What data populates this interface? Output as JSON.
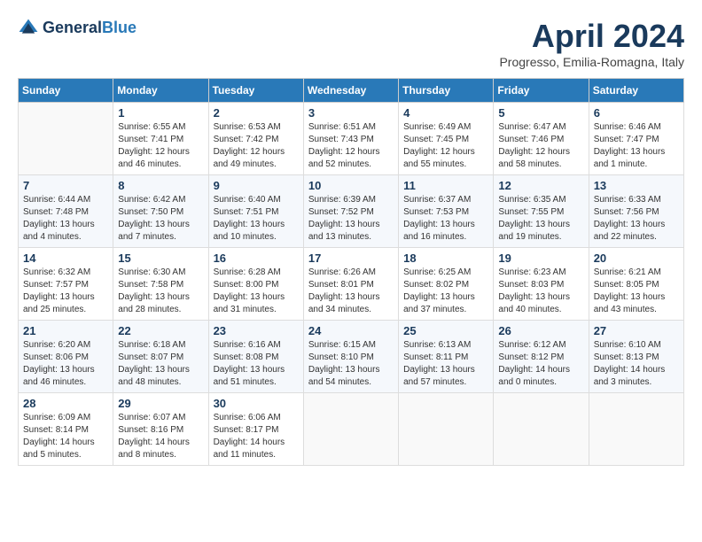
{
  "header": {
    "logo_line1": "General",
    "logo_line2": "Blue",
    "title": "April 2024",
    "subtitle": "Progresso, Emilia-Romagna, Italy"
  },
  "weekdays": [
    "Sunday",
    "Monday",
    "Tuesday",
    "Wednesday",
    "Thursday",
    "Friday",
    "Saturday"
  ],
  "weeks": [
    [
      {
        "day": "",
        "sunrise": "",
        "sunset": "",
        "daylight": ""
      },
      {
        "day": "1",
        "sunrise": "Sunrise: 6:55 AM",
        "sunset": "Sunset: 7:41 PM",
        "daylight": "Daylight: 12 hours and 46 minutes."
      },
      {
        "day": "2",
        "sunrise": "Sunrise: 6:53 AM",
        "sunset": "Sunset: 7:42 PM",
        "daylight": "Daylight: 12 hours and 49 minutes."
      },
      {
        "day": "3",
        "sunrise": "Sunrise: 6:51 AM",
        "sunset": "Sunset: 7:43 PM",
        "daylight": "Daylight: 12 hours and 52 minutes."
      },
      {
        "day": "4",
        "sunrise": "Sunrise: 6:49 AM",
        "sunset": "Sunset: 7:45 PM",
        "daylight": "Daylight: 12 hours and 55 minutes."
      },
      {
        "day": "5",
        "sunrise": "Sunrise: 6:47 AM",
        "sunset": "Sunset: 7:46 PM",
        "daylight": "Daylight: 12 hours and 58 minutes."
      },
      {
        "day": "6",
        "sunrise": "Sunrise: 6:46 AM",
        "sunset": "Sunset: 7:47 PM",
        "daylight": "Daylight: 13 hours and 1 minute."
      }
    ],
    [
      {
        "day": "7",
        "sunrise": "Sunrise: 6:44 AM",
        "sunset": "Sunset: 7:48 PM",
        "daylight": "Daylight: 13 hours and 4 minutes."
      },
      {
        "day": "8",
        "sunrise": "Sunrise: 6:42 AM",
        "sunset": "Sunset: 7:50 PM",
        "daylight": "Daylight: 13 hours and 7 minutes."
      },
      {
        "day": "9",
        "sunrise": "Sunrise: 6:40 AM",
        "sunset": "Sunset: 7:51 PM",
        "daylight": "Daylight: 13 hours and 10 minutes."
      },
      {
        "day": "10",
        "sunrise": "Sunrise: 6:39 AM",
        "sunset": "Sunset: 7:52 PM",
        "daylight": "Daylight: 13 hours and 13 minutes."
      },
      {
        "day": "11",
        "sunrise": "Sunrise: 6:37 AM",
        "sunset": "Sunset: 7:53 PM",
        "daylight": "Daylight: 13 hours and 16 minutes."
      },
      {
        "day": "12",
        "sunrise": "Sunrise: 6:35 AM",
        "sunset": "Sunset: 7:55 PM",
        "daylight": "Daylight: 13 hours and 19 minutes."
      },
      {
        "day": "13",
        "sunrise": "Sunrise: 6:33 AM",
        "sunset": "Sunset: 7:56 PM",
        "daylight": "Daylight: 13 hours and 22 minutes."
      }
    ],
    [
      {
        "day": "14",
        "sunrise": "Sunrise: 6:32 AM",
        "sunset": "Sunset: 7:57 PM",
        "daylight": "Daylight: 13 hours and 25 minutes."
      },
      {
        "day": "15",
        "sunrise": "Sunrise: 6:30 AM",
        "sunset": "Sunset: 7:58 PM",
        "daylight": "Daylight: 13 hours and 28 minutes."
      },
      {
        "day": "16",
        "sunrise": "Sunrise: 6:28 AM",
        "sunset": "Sunset: 8:00 PM",
        "daylight": "Daylight: 13 hours and 31 minutes."
      },
      {
        "day": "17",
        "sunrise": "Sunrise: 6:26 AM",
        "sunset": "Sunset: 8:01 PM",
        "daylight": "Daylight: 13 hours and 34 minutes."
      },
      {
        "day": "18",
        "sunrise": "Sunrise: 6:25 AM",
        "sunset": "Sunset: 8:02 PM",
        "daylight": "Daylight: 13 hours and 37 minutes."
      },
      {
        "day": "19",
        "sunrise": "Sunrise: 6:23 AM",
        "sunset": "Sunset: 8:03 PM",
        "daylight": "Daylight: 13 hours and 40 minutes."
      },
      {
        "day": "20",
        "sunrise": "Sunrise: 6:21 AM",
        "sunset": "Sunset: 8:05 PM",
        "daylight": "Daylight: 13 hours and 43 minutes."
      }
    ],
    [
      {
        "day": "21",
        "sunrise": "Sunrise: 6:20 AM",
        "sunset": "Sunset: 8:06 PM",
        "daylight": "Daylight: 13 hours and 46 minutes."
      },
      {
        "day": "22",
        "sunrise": "Sunrise: 6:18 AM",
        "sunset": "Sunset: 8:07 PM",
        "daylight": "Daylight: 13 hours and 48 minutes."
      },
      {
        "day": "23",
        "sunrise": "Sunrise: 6:16 AM",
        "sunset": "Sunset: 8:08 PM",
        "daylight": "Daylight: 13 hours and 51 minutes."
      },
      {
        "day": "24",
        "sunrise": "Sunrise: 6:15 AM",
        "sunset": "Sunset: 8:10 PM",
        "daylight": "Daylight: 13 hours and 54 minutes."
      },
      {
        "day": "25",
        "sunrise": "Sunrise: 6:13 AM",
        "sunset": "Sunset: 8:11 PM",
        "daylight": "Daylight: 13 hours and 57 minutes."
      },
      {
        "day": "26",
        "sunrise": "Sunrise: 6:12 AM",
        "sunset": "Sunset: 8:12 PM",
        "daylight": "Daylight: 14 hours and 0 minutes."
      },
      {
        "day": "27",
        "sunrise": "Sunrise: 6:10 AM",
        "sunset": "Sunset: 8:13 PM",
        "daylight": "Daylight: 14 hours and 3 minutes."
      }
    ],
    [
      {
        "day": "28",
        "sunrise": "Sunrise: 6:09 AM",
        "sunset": "Sunset: 8:14 PM",
        "daylight": "Daylight: 14 hours and 5 minutes."
      },
      {
        "day": "29",
        "sunrise": "Sunrise: 6:07 AM",
        "sunset": "Sunset: 8:16 PM",
        "daylight": "Daylight: 14 hours and 8 minutes."
      },
      {
        "day": "30",
        "sunrise": "Sunrise: 6:06 AM",
        "sunset": "Sunset: 8:17 PM",
        "daylight": "Daylight: 14 hours and 11 minutes."
      },
      {
        "day": "",
        "sunrise": "",
        "sunset": "",
        "daylight": ""
      },
      {
        "day": "",
        "sunrise": "",
        "sunset": "",
        "daylight": ""
      },
      {
        "day": "",
        "sunrise": "",
        "sunset": "",
        "daylight": ""
      },
      {
        "day": "",
        "sunrise": "",
        "sunset": "",
        "daylight": ""
      }
    ]
  ]
}
